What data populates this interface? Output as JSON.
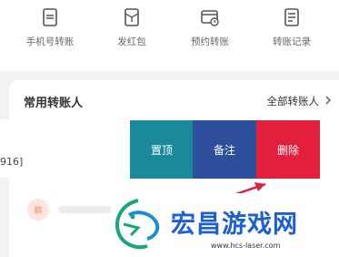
{
  "quick_actions": [
    {
      "label": "手机号转账",
      "icon": "phone-transfer-icon"
    },
    {
      "label": "发红包",
      "icon": "red-packet-icon"
    },
    {
      "label": "预约转账",
      "icon": "scheduled-transfer-icon"
    },
    {
      "label": "转账记录",
      "icon": "transfer-records-icon"
    }
  ],
  "payees": {
    "title": "常用转账人",
    "all_link": "全部转账人"
  },
  "swiped_row": {
    "text": "916]",
    "actions": {
      "pin": "置顶",
      "note": "备注",
      "delete": "删除"
    }
  },
  "row2": {
    "avatar_text": "鹏"
  },
  "watermark": {
    "title": "宏昌游戏网",
    "url": "www.hcs-laser.com"
  },
  "colors": {
    "pin": "#1a8a9a",
    "note": "#2d4f9c",
    "delete": "#e21f3c",
    "watermark_blue": "#1b5fd2"
  }
}
